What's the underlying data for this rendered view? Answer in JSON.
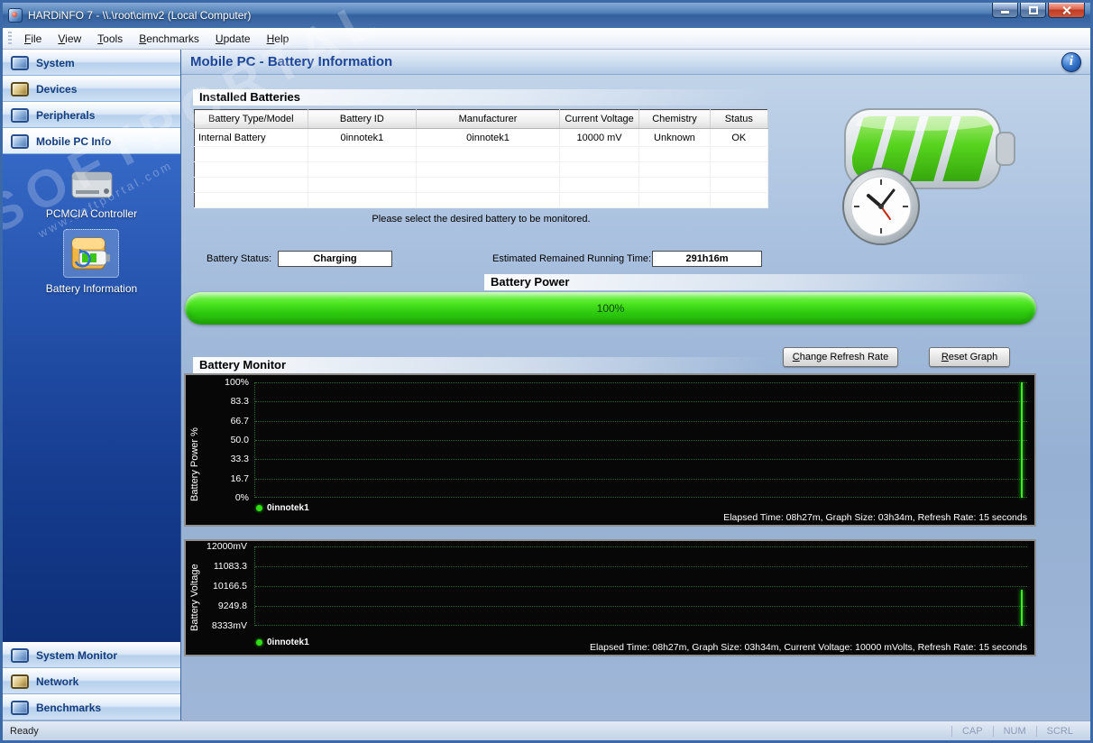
{
  "window": {
    "title": "HARDiNFO 7 - \\\\.\\root\\cimv2 (Local Computer)",
    "status": "Ready",
    "status_indicators": [
      "CAP",
      "NUM",
      "SCRL"
    ]
  },
  "icons": {
    "info_glyph": "i"
  },
  "menu": [
    "File",
    "View",
    "Tools",
    "Benchmarks",
    "Update",
    "Help"
  ],
  "sidebar": {
    "top_items": [
      {
        "label": "System"
      },
      {
        "label": "Devices"
      },
      {
        "label": "Peripherals"
      },
      {
        "label": "Mobile PC Info",
        "selected": true
      }
    ],
    "panel_items": [
      {
        "label": "PCMCIA Controller"
      },
      {
        "label": "Battery Information",
        "selected": true
      }
    ],
    "bottom_items": [
      {
        "label": "System Monitor"
      },
      {
        "label": "Network"
      },
      {
        "label": "Benchmarks"
      }
    ]
  },
  "header": {
    "title": "Mobile PC - Battery Information"
  },
  "watermark": {
    "text": "SOFTPORTAL",
    "subtext": "www.softportal.com"
  },
  "installed_batteries": {
    "section_title": "Installed Batteries",
    "columns": [
      "Battery Type/Model",
      "Battery ID",
      "Manufacturer",
      "Current Voltage",
      "Chemistry",
      "Status"
    ],
    "rows": [
      [
        "Internal Battery",
        "0innotek1",
        "0innotek1",
        "10000 mV",
        "Unknown",
        "OK"
      ]
    ],
    "hint": "Please select the desired battery to be monitored."
  },
  "battery_status": {
    "label": "Battery Status:",
    "value": "Charging",
    "time_label": "Estimated Remained Running Time:",
    "time_value": "291h16m"
  },
  "battery_power": {
    "section_title": "Battery Power",
    "percent": "100%"
  },
  "battery_monitor": {
    "section_title": "Battery Monitor",
    "buttons": [
      "Change Refresh Rate",
      "Reset Graph"
    ],
    "power_graph": {
      "ylabel": "Battery Power %",
      "yticks": [
        "100%",
        "83.3",
        "66.7",
        "50.0",
        "33.3",
        "16.7",
        "0%"
      ],
      "legend": "0innotek1",
      "current_value_percent": 100,
      "footer": "Elapsed Time: 08h27m, Graph Size: 03h34m, Refresh Rate: 15 seconds"
    },
    "voltage_graph": {
      "ylabel": "Battery Voltage",
      "yticks": [
        "12000mV",
        "11083.3",
        "10166.5",
        "9249.8",
        "8333mV"
      ],
      "legend": "0innotek1",
      "current_value_mv": 10000,
      "footer": "Elapsed Time: 08h27m, Graph Size: 03h34m, Current Voltage: 10000 mVolts, Refresh Rate: 15 seconds"
    }
  }
}
